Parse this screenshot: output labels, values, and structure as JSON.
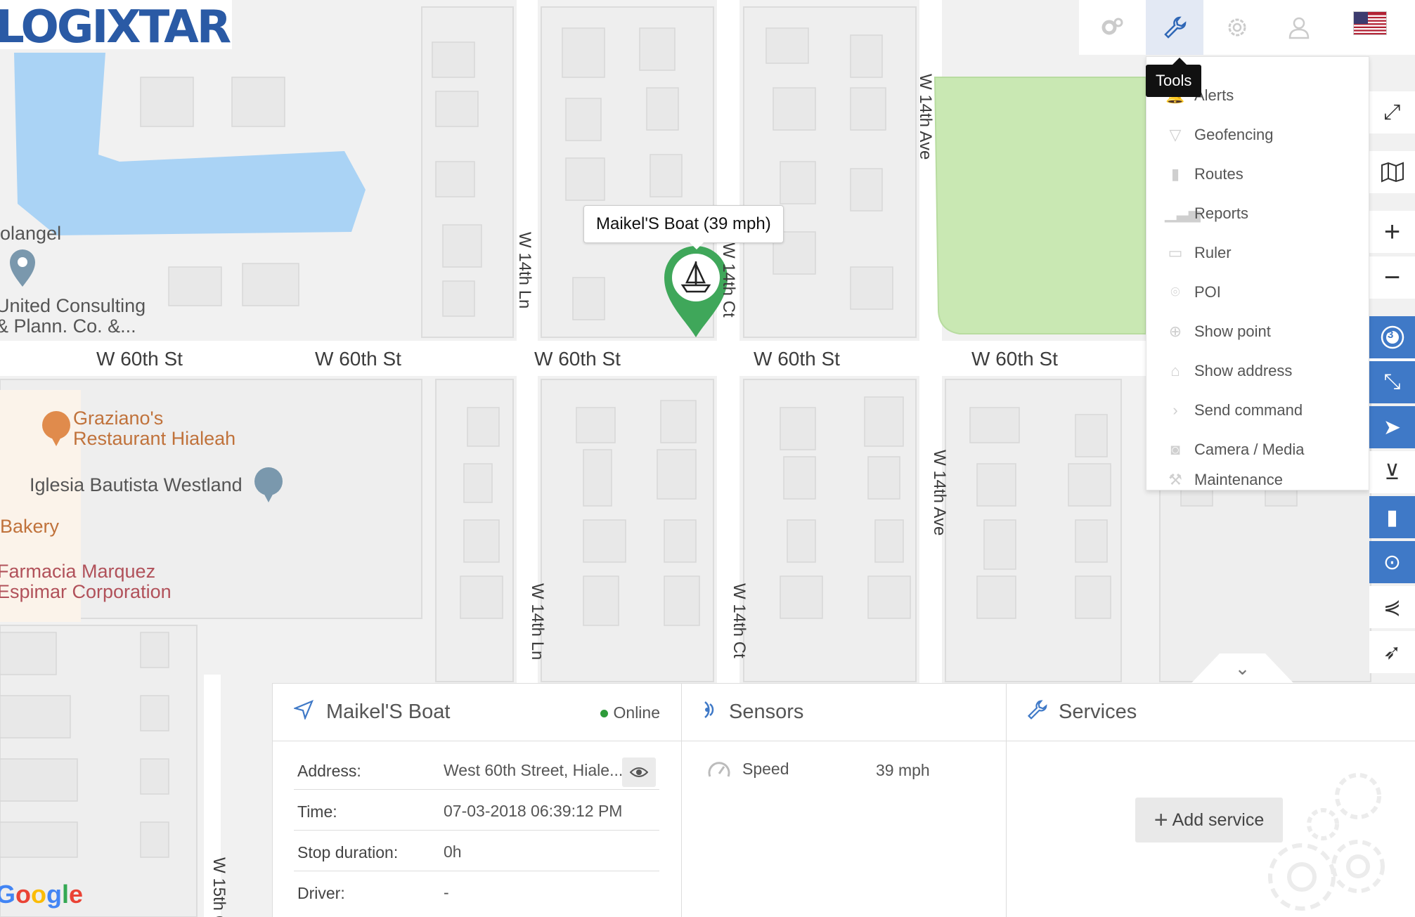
{
  "header": {
    "logo_text": "LOGIXTAR",
    "top_icons": [
      {
        "name": "settings-gears-icon",
        "active": false
      },
      {
        "name": "wrench-icon",
        "active": true
      },
      {
        "name": "gear-icon",
        "active": false
      },
      {
        "name": "user-icon",
        "active": false
      }
    ],
    "language_flag": "us-flag-icon"
  },
  "tooltip": {
    "text": "Tools"
  },
  "tools_menu": {
    "items": [
      {
        "label": "Alerts",
        "icon": "bell-icon"
      },
      {
        "label": "Geofencing",
        "icon": "geofence-icon"
      },
      {
        "label": "Routes",
        "icon": "road-icon"
      },
      {
        "label": "Reports",
        "icon": "bar-chart-icon"
      },
      {
        "label": "Ruler",
        "icon": "ruler-icon"
      },
      {
        "label": "POI",
        "icon": "pin-icon"
      },
      {
        "label": "Show point",
        "icon": "crosshair-icon"
      },
      {
        "label": "Show address",
        "icon": "home-icon"
      },
      {
        "label": "Send command",
        "icon": "chevron-right-icon"
      },
      {
        "label": "Camera / Media",
        "icon": "camera-icon"
      },
      {
        "label": "Maintenance",
        "icon": "wrench-icon"
      }
    ]
  },
  "right_toolbar": {
    "buttons": [
      {
        "name": "fullscreen-icon",
        "style": "white"
      },
      {
        "name": "map-layers-icon",
        "style": "white"
      },
      {
        "name": "zoom-in-icon",
        "style": "white"
      },
      {
        "name": "zoom-out-icon",
        "style": "white"
      },
      {
        "name": "objects-count-icon",
        "style": "blue",
        "badge": "3"
      },
      {
        "name": "fit-bounds-icon",
        "style": "blue"
      },
      {
        "name": "navigation-arrow-icon",
        "style": "blue"
      },
      {
        "name": "geofence-toggle-icon",
        "style": "white"
      },
      {
        "name": "routes-toggle-icon",
        "style": "blue"
      },
      {
        "name": "poi-toggle-icon",
        "style": "blue"
      },
      {
        "name": "history-icon",
        "style": "white"
      },
      {
        "name": "follow-icon",
        "style": "white"
      }
    ]
  },
  "map": {
    "street_names": {
      "w60_a": "W 60th St",
      "w60_b": "W 60th St",
      "w60_c": "W 60th St",
      "w60_d": "W 60th St",
      "w60_e": "W 60th St",
      "w14ln_top": "W 14th Ln",
      "w14ct_top": "W 14th Ct",
      "w14ave_top": "W 14th Ave",
      "w14ln_bottom": "W 14th Ln",
      "w14ct_bottom": "W 14th Ct",
      "w14ave_bottom": "W 14th Ave",
      "w15th": "W 15th C"
    },
    "pois": {
      "solangel": "olangel",
      "united_consulting": "United Consulting\n& Plann. Co. &...",
      "graziano": "Graziano's\nRestaurant Hialeah",
      "iglesia": "Iglesia Bautista Westland",
      "bakery": "Bakery",
      "farmacia": "Farmacia Marquez\nEspimar Corporation"
    },
    "attribution": "Google",
    "vehicle_label": "Maikel'S Boat (39 mph)",
    "vehicle_icon": "boat-icon",
    "colors": {
      "water": "#aad3f5",
      "park": "#c9e8b3",
      "marker": "#3fa75a"
    }
  },
  "object_panel": {
    "title": "Maikel'S Boat",
    "status": "Online",
    "rows": [
      {
        "key": "Address:",
        "value": "West 60th Street, Hiale..."
      },
      {
        "key": "Time:",
        "value": "07-03-2018 06:39:12 PM"
      },
      {
        "key": "Stop duration:",
        "value": "0h"
      },
      {
        "key": "Driver:",
        "value": "-"
      }
    ]
  },
  "sensors_panel": {
    "title": "Sensors",
    "rows": [
      {
        "name": "Speed",
        "value": "39 mph"
      }
    ]
  },
  "services_panel": {
    "title": "Services",
    "add_button": "Add service"
  }
}
